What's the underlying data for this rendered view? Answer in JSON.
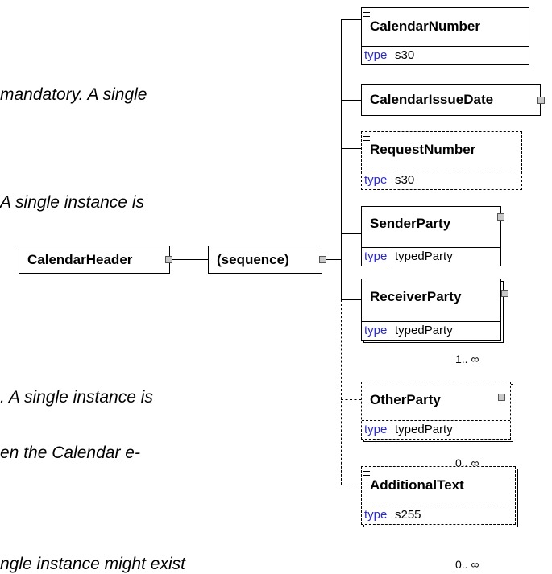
{
  "notes": [
    "mandatory. A single",
    "A single instance is",
    ". A single instance is",
    "en the Calendar e-",
    "ngle instance might exist"
  ],
  "root": {
    "name": "CalendarHeader"
  },
  "sequence": {
    "label": "(sequence)"
  },
  "type_key": "type",
  "elements": [
    {
      "name": "CalendarNumber",
      "type": "s30",
      "optional": false,
      "multiple": false,
      "has_doc": true,
      "has_children": false,
      "cardinality": ""
    },
    {
      "name": "CalendarIssueDate",
      "type": "",
      "optional": false,
      "multiple": false,
      "has_doc": false,
      "has_children": true,
      "cardinality": ""
    },
    {
      "name": "RequestNumber",
      "type": "s30",
      "optional": true,
      "multiple": false,
      "has_doc": true,
      "has_children": false,
      "cardinality": ""
    },
    {
      "name": "SenderParty",
      "type": "typedParty",
      "optional": false,
      "multiple": false,
      "has_doc": false,
      "has_children": true,
      "cardinality": ""
    },
    {
      "name": "ReceiverParty",
      "type": "typedParty",
      "optional": false,
      "multiple": true,
      "has_doc": false,
      "has_children": true,
      "cardinality": "1.. ∞"
    },
    {
      "name": "OtherParty",
      "type": "typedParty",
      "optional": true,
      "multiple": true,
      "has_doc": false,
      "has_children": true,
      "cardinality": "0.. ∞"
    },
    {
      "name": "AdditionalText",
      "type": "s255",
      "optional": true,
      "multiple": true,
      "has_doc": true,
      "has_children": false,
      "cardinality": "0.. ∞"
    }
  ]
}
